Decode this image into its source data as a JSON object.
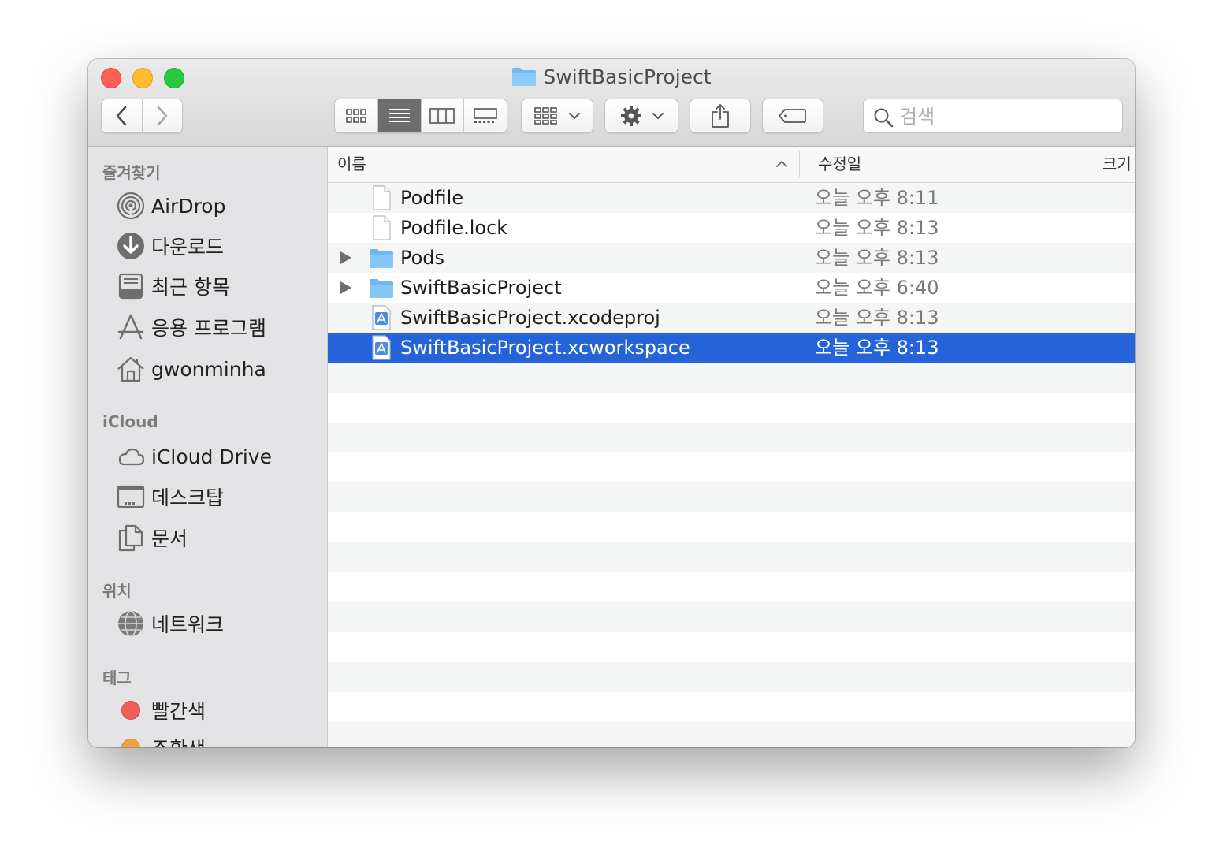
{
  "window": {
    "title": "SwiftBasicProject"
  },
  "toolbar": {
    "search_placeholder": "검색",
    "view_modes": [
      "icon",
      "list",
      "column",
      "gallery"
    ],
    "active_view": "list"
  },
  "sidebar": {
    "favorites_heading": "즐겨찾기",
    "favorites": [
      {
        "label": "AirDrop",
        "icon": "airdrop-icon"
      },
      {
        "label": "다운로드",
        "icon": "download-icon"
      },
      {
        "label": "최근 항목",
        "icon": "recents-icon"
      },
      {
        "label": "응용 프로그램",
        "icon": "applications-icon"
      },
      {
        "label": "gwonminha",
        "icon": "home-icon"
      }
    ],
    "icloud_heading": "iCloud",
    "icloud": [
      {
        "label": "iCloud Drive",
        "icon": "cloud-icon"
      },
      {
        "label": "데스크탑",
        "icon": "desktop-icon"
      },
      {
        "label": "문서",
        "icon": "documents-icon"
      }
    ],
    "locations_heading": "위치",
    "locations": [
      {
        "label": "네트워크",
        "icon": "network-icon"
      }
    ],
    "tags_heading": "태그",
    "tags": [
      {
        "label": "빨간색",
        "color": "#ec5f58"
      },
      {
        "label": "주황색",
        "color": "#f1a33b"
      }
    ]
  },
  "list": {
    "columns": {
      "name": "이름",
      "modified": "수정일",
      "size": "크기"
    },
    "rows": [
      {
        "name": "Podfile",
        "modified": "오늘 오후 8:11",
        "kind": "file",
        "expandable": false
      },
      {
        "name": "Podfile.lock",
        "modified": "오늘 오후 8:13",
        "kind": "file",
        "expandable": false
      },
      {
        "name": "Pods",
        "modified": "오늘 오후 8:13",
        "kind": "folder",
        "expandable": true
      },
      {
        "name": "SwiftBasicProject",
        "modified": "오늘 오후 6:40",
        "kind": "folder",
        "expandable": true
      },
      {
        "name": "SwiftBasicProject.xcodeproj",
        "modified": "오늘 오후 8:13",
        "kind": "xcode",
        "expandable": false
      },
      {
        "name": "SwiftBasicProject.xcworkspace",
        "modified": "오늘 오후 8:13",
        "kind": "xcode",
        "expandable": false,
        "selected": true
      }
    ]
  },
  "colors": {
    "selection": "#2463d8",
    "folder": "#6fb8ef"
  }
}
